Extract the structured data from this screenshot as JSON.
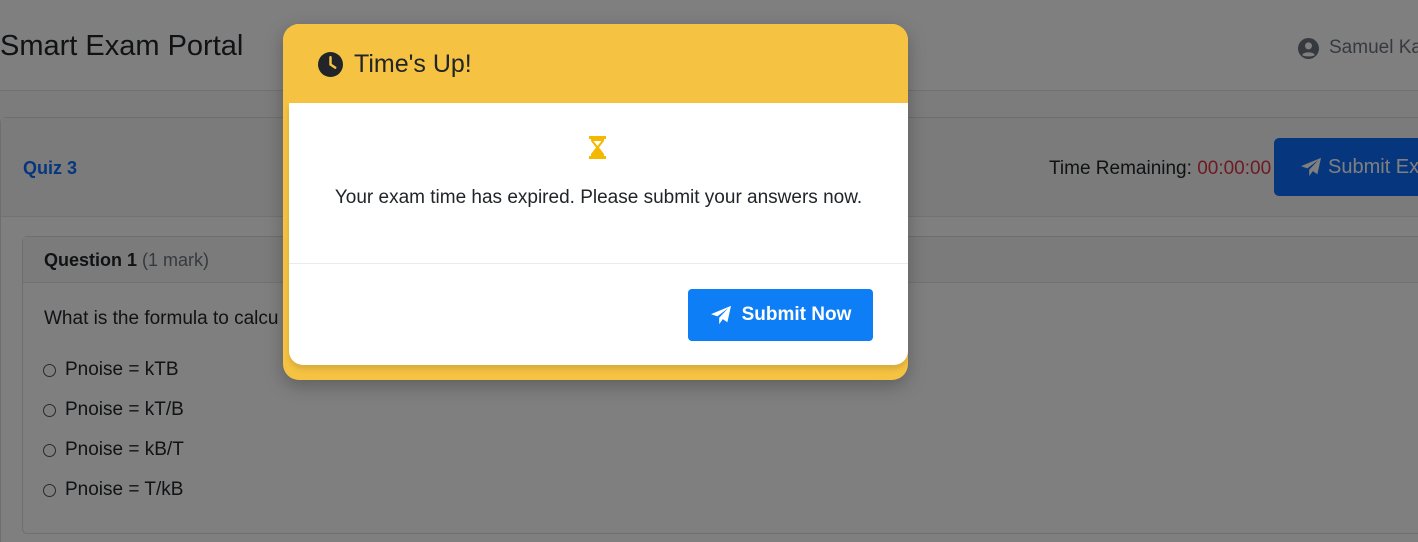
{
  "app": {
    "title": "Smart Exam Portal",
    "user_name": "Samuel Ka",
    "user_icon": "user-circle-icon"
  },
  "quiz": {
    "title": "Quiz 3",
    "time_remaining_label": "Time Remaining:",
    "time_remaining_value": "00:00:00",
    "submit_exam_label": "Submit Exa",
    "submit_icon": "paper-plane-icon"
  },
  "question": {
    "label": "Question 1",
    "mark": "(1 mark)",
    "text": "What is the formula to calcu",
    "options": [
      "Pnoise = kTB",
      "Pnoise = kT/B",
      "Pnoise = kB/T",
      "Pnoise = T/kB"
    ]
  },
  "modal": {
    "title": "Time's Up!",
    "title_icon": "clock-icon",
    "body_icon": "hourglass-icon",
    "message": "Your exam time has expired. Please submit your answers now.",
    "submit_label": "Submit Now",
    "submit_icon": "paper-plane-icon"
  },
  "colors": {
    "accent_blue": "#0d6efd",
    "modal_warning": "#f5c242",
    "timer_red": "#dc3545"
  }
}
